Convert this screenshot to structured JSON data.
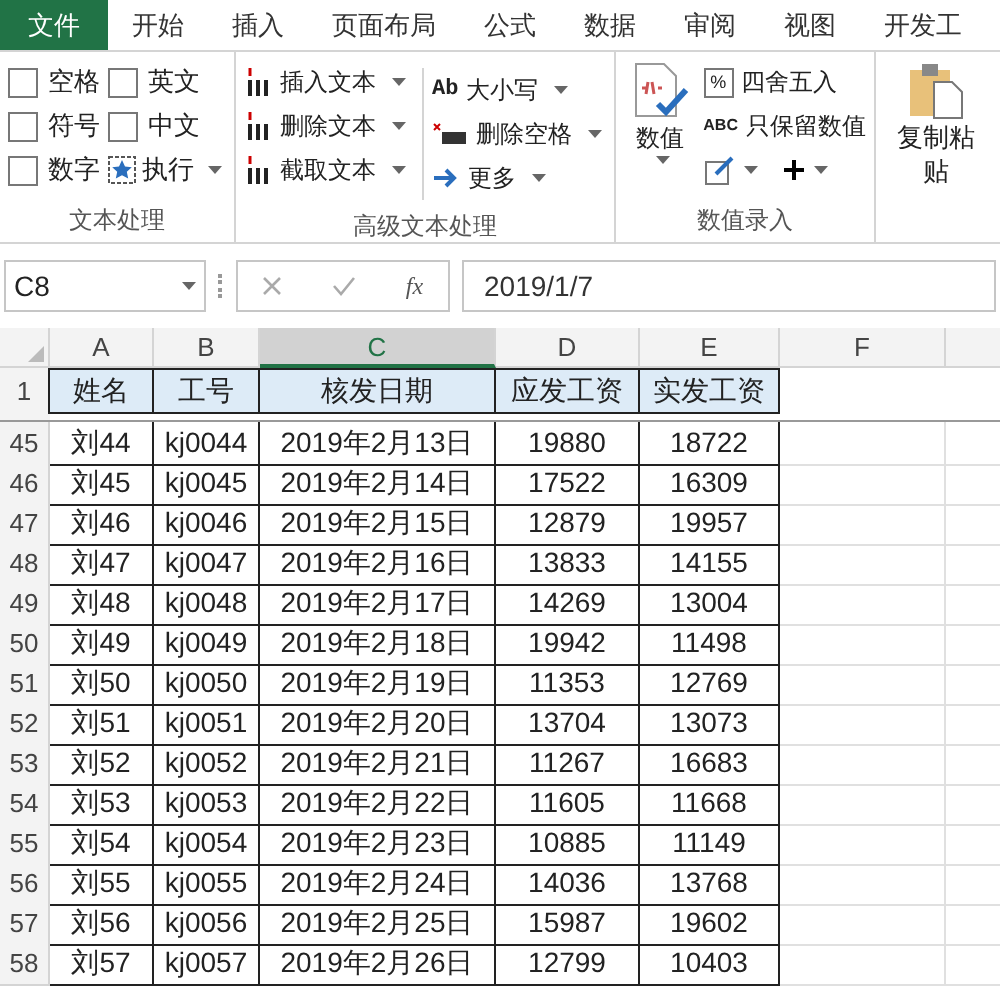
{
  "tabs": [
    {
      "label": "文件",
      "selected": true
    },
    {
      "label": "开始",
      "selected": false
    },
    {
      "label": "插入",
      "selected": false
    },
    {
      "label": "页面布局",
      "selected": false
    },
    {
      "label": "公式",
      "selected": false
    },
    {
      "label": "数据",
      "selected": false
    },
    {
      "label": "审阅",
      "selected": false
    },
    {
      "label": "视图",
      "selected": false
    },
    {
      "label": "开发工",
      "selected": false
    }
  ],
  "ribbon": {
    "text_group": {
      "label": "文本处理",
      "checkboxes": [
        {
          "label": "空格",
          "checked": false
        },
        {
          "label": "英文",
          "checked": false
        },
        {
          "label": "符号",
          "checked": false
        },
        {
          "label": "中文",
          "checked": false
        },
        {
          "label": "数字",
          "checked": false
        }
      ],
      "run": "执行"
    },
    "advanced_group": {
      "label": "高级文本处理",
      "left": [
        "插入文本",
        "删除文本",
        "截取文本"
      ],
      "case_icon": "Ab",
      "right": [
        "大小写",
        "删除空格",
        "更多"
      ]
    },
    "number_group": {
      "label": "数值录入",
      "big": "数值",
      "round_icon": "%",
      "round": "四舍五入",
      "keep_icon": "ABC",
      "keep": "只保留数值"
    },
    "paste": "复制粘贴"
  },
  "formula_bar": {
    "name_box": "C8",
    "function_icon": "fx",
    "formula": "2019/1/7"
  },
  "sheet": {
    "columns": [
      {
        "label": "A",
        "selected": false
      },
      {
        "label": "B",
        "selected": false
      },
      {
        "label": "C",
        "selected": true
      },
      {
        "label": "D",
        "selected": false
      },
      {
        "label": "E",
        "selected": false
      },
      {
        "label": "F",
        "selected": false
      }
    ],
    "header": {
      "row": "1",
      "cells": [
        "姓名",
        "工号",
        "核发日期",
        "应发工资",
        "实发工资"
      ]
    },
    "rows": [
      {
        "row": "45",
        "cells": [
          "刘44",
          "kj0044",
          "2019年2月13日",
          "19880",
          "18722"
        ]
      },
      {
        "row": "46",
        "cells": [
          "刘45",
          "kj0045",
          "2019年2月14日",
          "17522",
          "16309"
        ]
      },
      {
        "row": "47",
        "cells": [
          "刘46",
          "kj0046",
          "2019年2月15日",
          "12879",
          "19957"
        ]
      },
      {
        "row": "48",
        "cells": [
          "刘47",
          "kj0047",
          "2019年2月16日",
          "13833",
          "14155"
        ]
      },
      {
        "row": "49",
        "cells": [
          "刘48",
          "kj0048",
          "2019年2月17日",
          "14269",
          "13004"
        ]
      },
      {
        "row": "50",
        "cells": [
          "刘49",
          "kj0049",
          "2019年2月18日",
          "19942",
          "11498"
        ]
      },
      {
        "row": "51",
        "cells": [
          "刘50",
          "kj0050",
          "2019年2月19日",
          "11353",
          "12769"
        ]
      },
      {
        "row": "52",
        "cells": [
          "刘51",
          "kj0051",
          "2019年2月20日",
          "13704",
          "13073"
        ]
      },
      {
        "row": "53",
        "cells": [
          "刘52",
          "kj0052",
          "2019年2月21日",
          "11267",
          "16683"
        ]
      },
      {
        "row": "54",
        "cells": [
          "刘53",
          "kj0053",
          "2019年2月22日",
          "11605",
          "11668"
        ]
      },
      {
        "row": "55",
        "cells": [
          "刘54",
          "kj0054",
          "2019年2月23日",
          "10885",
          "11149"
        ]
      },
      {
        "row": "56",
        "cells": [
          "刘55",
          "kj0055",
          "2019年2月24日",
          "14036",
          "13768"
        ]
      },
      {
        "row": "57",
        "cells": [
          "刘56",
          "kj0056",
          "2019年2月25日",
          "15987",
          "19602"
        ]
      },
      {
        "row": "58",
        "cells": [
          "刘57",
          "kj0057",
          "2019年2月26日",
          "12799",
          "10403"
        ]
      }
    ]
  }
}
